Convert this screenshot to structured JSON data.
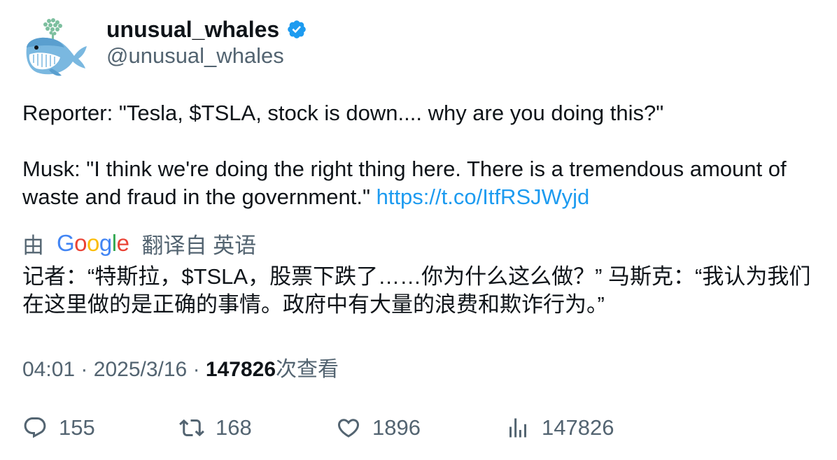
{
  "author": {
    "display_name": "unusual_whales",
    "handle": "@unusual_whales",
    "avatar_icon": "whale-logo-icon",
    "verified_icon": "verified-badge-icon",
    "verified_color": "#1d9bf0"
  },
  "tweet": {
    "line1": "Reporter: \"Tesla, $TSLA, stock is down.... why are you doing this?\"",
    "line2": "Musk: \"I think we're doing the right thing here. There is a tremendous amount of waste and fraud in the government.\"",
    "link": "https://t.co/ItfRSJWyjd",
    "link_color": "#1d9bf0"
  },
  "translation": {
    "by_label": "由",
    "google_logo_text": "Google",
    "from_label": "翻译自 英语",
    "text": "记者：“特斯拉，$TSLA，股票下跌了……你为什么这么做？” 马斯克：“我认为我们在这里做的是正确的事情。政府中有大量的浪费和欺诈行为。”"
  },
  "meta": {
    "time": "04:01",
    "separator": "·",
    "date": "2025/3/16",
    "views_count": "147826",
    "views_label": "次查看"
  },
  "actions": {
    "reply_count": "155",
    "retweet_count": "168",
    "like_count": "1896",
    "views_count": "147826"
  },
  "colors": {
    "text_primary": "#0f1419",
    "text_secondary": "#536471",
    "google_blue": "#4285f4",
    "google_red": "#ea4335",
    "google_yellow": "#fbbc05",
    "google_green": "#34a853"
  }
}
